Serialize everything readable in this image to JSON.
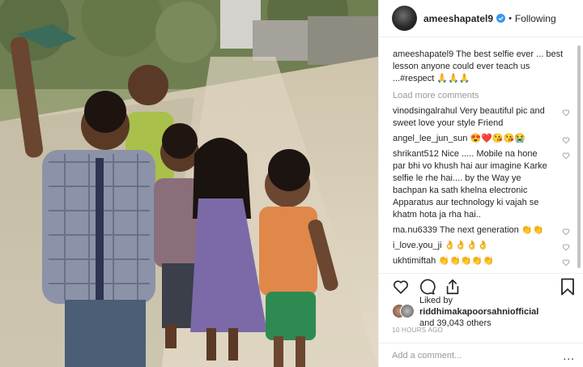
{
  "post": {
    "image_alt": "",
    "author": {
      "username": "ameeshapatel9",
      "verified": true,
      "follow_status": "Following"
    },
    "caption": {
      "username": "ameeshapatel9",
      "text": "The best selfie ever ... best lesson anyone could ever teach us ...#respect 🙏🙏🙏"
    },
    "load_more": "Load more comments",
    "comments": [
      {
        "username": "vinodsingalrahul",
        "text": "Very beautiful pic and sweet love your style Friend"
      },
      {
        "username": "angel_lee_jun_sun",
        "text": "😍❤️😘😘😭"
      },
      {
        "username": "shrikant512",
        "text": "Nice ..... Mobile na hone par bhi vo khush hai aur imagine Karke selfie le rhe hai.... by the Way ye bachpan ka sath khelna electronic Apparatus aur technology ki vajah se khatm hota ja rha hai.."
      },
      {
        "username": "ma.nu6339",
        "text": "The next generation 👏👏"
      },
      {
        "username": "i_love.you_ji",
        "text": "👌👌👌👌"
      },
      {
        "username": "ukhtimiftah",
        "text": "👏👏👏👏👏"
      }
    ],
    "likes": {
      "prefix": "Liked by",
      "first_user": "riddhimakapoorsahniofficial",
      "rest": "and 39,043 others"
    },
    "timestamp": "10 HOURS AGO",
    "add_comment_placeholder": "Add a comment...",
    "more_options": "..."
  },
  "icons": {
    "verified": "verified-badge-icon",
    "heart": "heart-outline-icon",
    "comment": "comment-bubble-icon",
    "share": "share-upload-icon",
    "bookmark": "bookmark-icon"
  },
  "colors": {
    "verified_blue": "#3897f0",
    "muted_text": "#999999",
    "border": "#efefef"
  }
}
